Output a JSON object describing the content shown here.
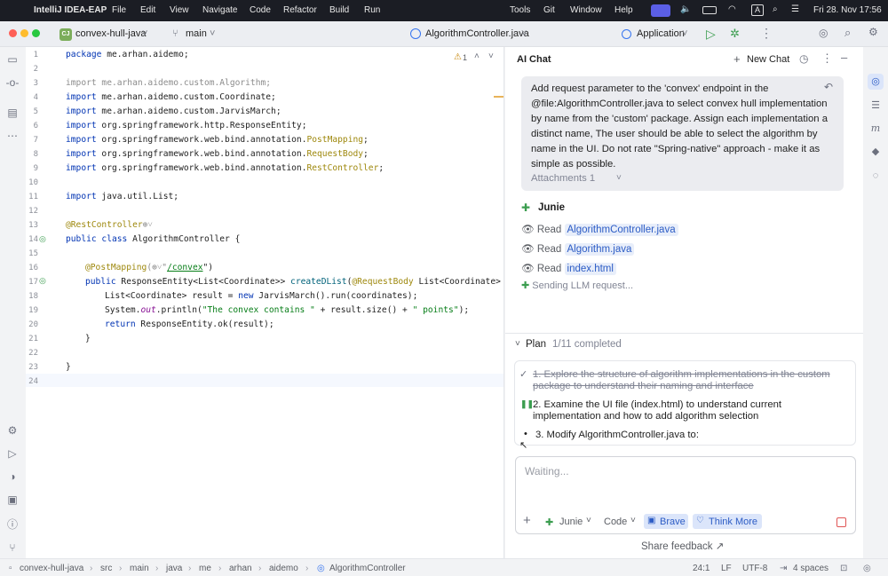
{
  "menubar": {
    "app": "IntelliJ IDEA-EAP",
    "items": [
      "File",
      "Edit",
      "View",
      "Navigate",
      "Code",
      "Refactor",
      "Build",
      "Run"
    ],
    "right_items": [
      "Tools",
      "Git",
      "Window",
      "Help"
    ],
    "datetime": "Fri 28. Nov  17:56"
  },
  "toolbar": {
    "project_badge": "CJ",
    "project": "convex-hull-java",
    "branch": "main",
    "file": "AlgorithmController.java",
    "run_config": "Application"
  },
  "editor": {
    "warning_count": "1",
    "line_numbers": [
      "1",
      "2",
      "3",
      "4",
      "5",
      "6",
      "7",
      "8",
      "9",
      "10",
      "11",
      "12",
      "13",
      "14",
      "15",
      "16",
      "17",
      "18",
      "19",
      "20",
      "21",
      "22",
      "23",
      "24"
    ],
    "lines": {
      "l1": [
        "package",
        " me.arhan.aidemo;"
      ],
      "l3": "import me.arhan.aidemo.custom.Algorithm;",
      "l4": [
        "import",
        " me.arhan.aidemo.custom.Coordinate;"
      ],
      "l5": [
        "import",
        " me.arhan.aidemo.custom.JarvisMarch;"
      ],
      "l6": [
        "import",
        " org.springframework.http.ResponseEntity;"
      ],
      "l7": [
        "import",
        " org.springframework.web.bind.annotation.",
        "PostMapping",
        ";"
      ],
      "l8": [
        "import",
        " org.springframework.web.bind.annotation.",
        "RequestBody",
        ";"
      ],
      "l9": [
        "import",
        " org.springframework.web.bind.annotation.",
        "RestController",
        ";"
      ],
      "l11": [
        "import",
        " java.util.List;"
      ],
      "l13": [
        "@RestController",
        "⊕˅"
      ],
      "l14": [
        "public class",
        " AlgorithmController {"
      ],
      "l16": [
        "@PostMapping",
        "(⊕˅\"",
        "/convex",
        "\")"
      ],
      "l17": [
        "public",
        " ResponseEntity<List<Coordinate>> ",
        "createDList",
        "(",
        "@RequestBody",
        " List<Coordinate> coo"
      ],
      "l18": [
        "List<Coordinate> result = ",
        "new",
        " JarvisMarch().run(coordinates);"
      ],
      "l19": [
        "System.",
        "out",
        ".println(",
        "\"The convex contains \"",
        " + result.size() + ",
        "\" points\"",
        ");"
      ],
      "l20": [
        "return",
        " ResponseEntity.ok(result);"
      ],
      "l21": "}",
      "l23": "}"
    }
  },
  "chat": {
    "title": "AI Chat",
    "new_chat": "New Chat",
    "user_message": "Add request parameter to the 'convex' endpoint in the @file:AlgorithmController.java to select convex hull implementation by name from the 'custom' package.  Assign each implementation a distinct name, The user should be able to select the algorithm by name in the UI. Do not rate \"Spring-native\" approach - make it as simple as possible.",
    "attachments": "Attachments 1",
    "agent_name": "Junie",
    "read_label": "Read",
    "read_files": [
      "AlgorithmController.java",
      "Algorithm.java",
      "index.html"
    ],
    "sending": "Sending LLM request...",
    "plan_title": "Plan",
    "plan_progress": "1/11 completed",
    "plan_items": [
      "1. Explore the structure of algorithm implementations in the custom package to understand their naming and interface",
      "2. Examine the UI file (index.html) to understand current implementation and how to add algorithm selection",
      "3. Modify AlgorithmController.java to:"
    ],
    "input_placeholder": "Waiting...",
    "agent_select": "Junie",
    "mode_select": "Code",
    "brave": "Brave",
    "think_more": "Think More",
    "share_feedback": "Share feedback ↗"
  },
  "status": {
    "breadcrumb": [
      "convex-hull-java",
      "src",
      "main",
      "java",
      "me",
      "arhan",
      "aidemo",
      "AlgorithmController"
    ],
    "position": "24:1",
    "line_sep": "LF",
    "encoding": "UTF-8",
    "indent": "4 spaces"
  }
}
